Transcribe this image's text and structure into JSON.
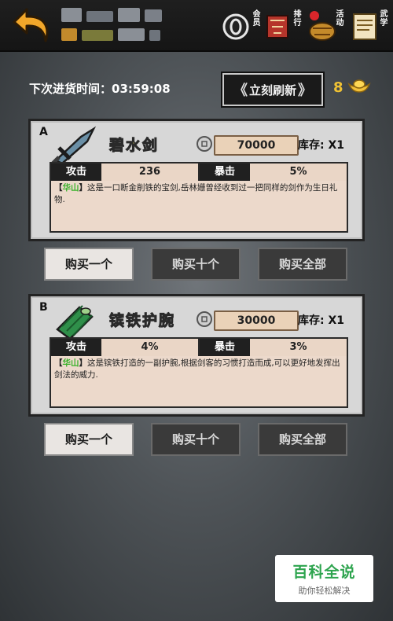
{
  "header": {
    "vip_label": "会员",
    "rank_label": "排行",
    "events_label": "活动",
    "kungfu_label": "武学"
  },
  "restock": {
    "label": "下次进货时间：",
    "countdown": "03:59:08"
  },
  "refresh": {
    "label": "立刻刷新"
  },
  "currency": {
    "gold": "8"
  },
  "items": [
    {
      "slot": "A",
      "name": "碧水剑",
      "price": "70000",
      "stock": "库存: X1",
      "stats": [
        {
          "label": "攻击",
          "value": "236"
        },
        {
          "label": "暴击",
          "value": "5%"
        }
      ],
      "sect_open": "【",
      "sect": "华山",
      "sect_close": "】",
      "description": "这是一口断金削铁的宝剑,岳林姗曾经收到过一把同样的剑作为生日礼物."
    },
    {
      "slot": "B",
      "name": "镔铁护腕",
      "price": "30000",
      "stock": "库存: X1",
      "stats": [
        {
          "label": "攻击",
          "value": "4%"
        },
        {
          "label": "暴击",
          "value": "3%"
        }
      ],
      "sect_open": "【",
      "sect": "华山",
      "sect_close": "】",
      "description": "这是镔铁打造的一副护腕,根据剑客的习惯打造而成,可以更好地发挥出剑法的威力."
    }
  ],
  "buttons": {
    "buy_one": "购买一个",
    "buy_ten": "购买十个",
    "buy_all": "购买全部"
  },
  "watermark": {
    "title": "百科全说",
    "subtitle": "助你轻松解决"
  },
  "colors": {
    "gold": "#f0c233",
    "item_name": "#e8e066",
    "sect": "#38b22a",
    "watermark_green": "#2da44e"
  }
}
